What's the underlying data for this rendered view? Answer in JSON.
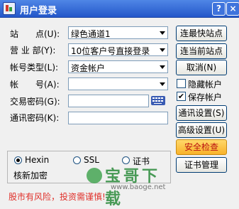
{
  "window": {
    "title": "用户登录",
    "help_label": "?",
    "close_label": "×"
  },
  "form": {
    "site_label": "站　　点(U):",
    "site_value": "绿色通道1",
    "branch_label": "营 业 部(Y):",
    "branch_value": "10位客户号直接登录",
    "account_type_label": "帐号类型(L):",
    "account_type_value": "资金帐户",
    "account_label": "帐　　号(A):",
    "account_value": "",
    "trade_pwd_label": "交易密码(G):",
    "trade_pwd_value": "",
    "comm_pwd_label": "通讯密码(K):",
    "comm_pwd_value": ""
  },
  "buttons": {
    "fastest": "连最快站点",
    "current": "连当前站点",
    "cancel": "取消(N)",
    "comm_settings": "通讯设置(S)",
    "advanced": "高级设置(U)",
    "security": "安全检查",
    "cert_mgmt": "证书管理"
  },
  "checks": {
    "hide_account": {
      "label": "隐藏帐户",
      "checked": false
    },
    "save_account": {
      "label": "保存帐户",
      "checked": true
    }
  },
  "protocol": {
    "options": [
      "Hexin",
      "SSL",
      "证书"
    ],
    "selected": "Hexin",
    "verify_label": "核新加密"
  },
  "watermark": {
    "text": "宝哥下载",
    "url": "www.baoge.net"
  },
  "footer": {
    "risk_warning": "股市有风险，投资需谨慎!"
  },
  "colors": {
    "titlebar": "#2f63d6",
    "warning": "#e0302a",
    "security_button": "#f8b22a"
  }
}
